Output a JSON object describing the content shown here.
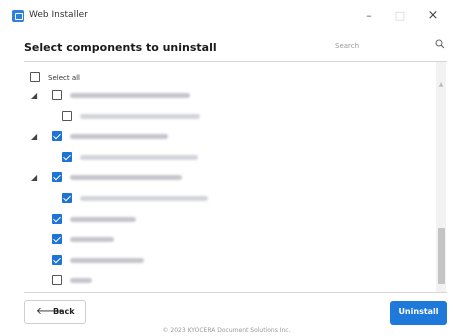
{
  "window": {
    "title": "Web Installer",
    "minimize": "–",
    "maximize": "□",
    "close": "×"
  },
  "page": {
    "heading": "Select components to uninstall"
  },
  "search": {
    "placeholder": "Search",
    "value": ""
  },
  "list": {
    "select_all": {
      "label": "Select all",
      "checked": false
    },
    "rows": [
      {
        "level": 0,
        "expander": "◢",
        "checked": false,
        "blur_width": 120
      },
      {
        "level": 1,
        "expander": "",
        "checked": false,
        "blur_width": 120
      },
      {
        "level": 0,
        "expander": "◢",
        "checked": true,
        "blur_width": 98
      },
      {
        "level": 1,
        "expander": "",
        "checked": true,
        "blur_width": 118
      },
      {
        "level": 0,
        "expander": "◢",
        "checked": true,
        "blur_width": 112
      },
      {
        "level": 1,
        "expander": "",
        "checked": true,
        "blur_width": 128
      },
      {
        "level": 0,
        "expander": "",
        "checked": true,
        "blur_width": 66
      },
      {
        "level": 0,
        "expander": "",
        "checked": true,
        "blur_width": 44
      },
      {
        "level": 0,
        "expander": "",
        "checked": true,
        "blur_width": 74
      },
      {
        "level": 0,
        "expander": "",
        "checked": false,
        "blur_width": 22
      }
    ]
  },
  "actions": {
    "back_label": "Back",
    "back_arrow": "🡐",
    "uninstall_label": "Uninstall"
  },
  "footer": {
    "copyright": "© 2023 KYOCERA Document Solutions Inc."
  },
  "colors": {
    "accent": "#1f79da",
    "checkbox_checked": "#1d73d6"
  }
}
